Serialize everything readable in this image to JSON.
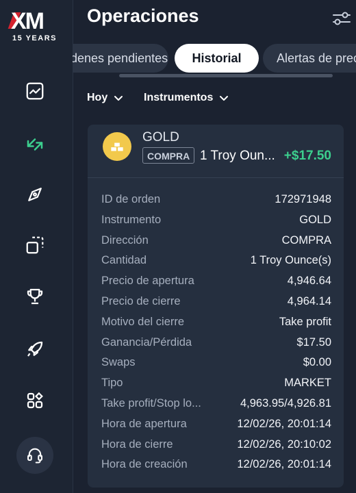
{
  "brand": {
    "logo_text": "XM",
    "logo_sub": "15 YEARS"
  },
  "header": {
    "title": "Operaciones"
  },
  "tabs": [
    {
      "label": "Órdenes pendientes"
    },
    {
      "label": "Historial"
    },
    {
      "label": "Alertas de precio"
    }
  ],
  "filters": {
    "date": "Hoy",
    "instruments": "Instrumentos"
  },
  "trade": {
    "symbol": "GOLD",
    "side": "COMPRA",
    "quantity": "1 Troy Oun...",
    "pnl": "+$17.50",
    "details": [
      {
        "label": "ID de orden",
        "value": "172971948"
      },
      {
        "label": "Instrumento",
        "value": "GOLD"
      },
      {
        "label": "Dirección",
        "value": "COMPRA"
      },
      {
        "label": "Cantidad",
        "value": "1 Troy Ounce(s)"
      },
      {
        "label": "Precio de apertura",
        "value": "4,946.64"
      },
      {
        "label": "Precio de cierre",
        "value": "4,964.14"
      },
      {
        "label": "Motivo del cierre",
        "value": "Take profit"
      },
      {
        "label": "Ganancia/Pérdida",
        "value": "$17.50"
      },
      {
        "label": "Swaps",
        "value": "$0.00"
      },
      {
        "label": "Tipo",
        "value": "MARKET"
      },
      {
        "label": "Take profit/Stop lo...",
        "value": "4,963.95/4,926.81"
      },
      {
        "label": "Hora de apertura",
        "value": "12/02/26, 20:01:14"
      },
      {
        "label": "Hora de cierre",
        "value": "12/02/26, 20:10:02"
      },
      {
        "label": "Hora de creación",
        "value": "12/02/26, 20:01:14"
      }
    ]
  },
  "colors": {
    "accent_green": "#3ccf8e",
    "gold": "#f2c94c",
    "brand_red": "#d5232f"
  },
  "sidebar": {
    "items": [
      {
        "icon": "chart-icon"
      },
      {
        "icon": "trade-arrows-icon",
        "active": true
      },
      {
        "icon": "compass-icon"
      },
      {
        "icon": "copy-squares-icon"
      },
      {
        "icon": "trophy-icon"
      },
      {
        "icon": "rocket-icon"
      },
      {
        "icon": "apps-grid-icon"
      }
    ],
    "support_icon": "headset-icon"
  }
}
